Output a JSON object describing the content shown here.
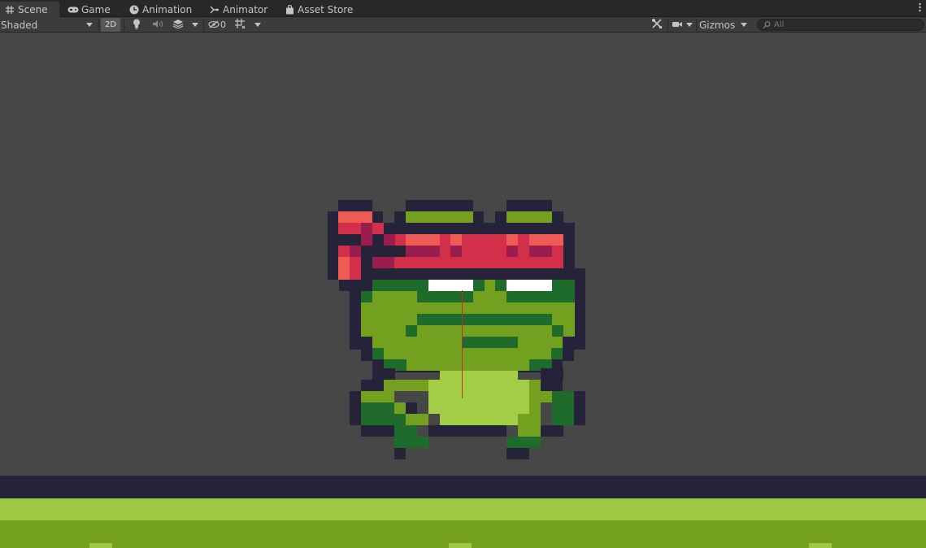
{
  "tabs": [
    {
      "label": "Scene",
      "icon": "grid-icon",
      "active": true
    },
    {
      "label": "Game",
      "icon": "gamepad-icon",
      "active": false
    },
    {
      "label": "Animation",
      "icon": "clock-icon",
      "active": false
    },
    {
      "label": "Animator",
      "icon": "animator-icon",
      "active": false
    },
    {
      "label": "Asset Store",
      "icon": "bag-icon",
      "active": false
    }
  ],
  "toolbar": {
    "shading_mode": "Shaded",
    "mode_2d_label": "2D",
    "hidden_count": "0",
    "gizmos_label": "Gizmos",
    "search_placeholder": "All"
  },
  "colors": {
    "scene_bg": "#474747",
    "ground_dark": "#26223a",
    "ground_light": "#a0c943",
    "ground_mid": "#74a01f",
    "frog_outline": "#26223a",
    "frog_body": "#74a01f",
    "frog_dark_green": "#1f6b2c",
    "frog_belly": "#a4cd46",
    "bandana_red": "#d12f4a",
    "bandana_light": "#ee5b54",
    "bandana_dark": "#9a1d4e",
    "eye_white": "#ffffff"
  }
}
